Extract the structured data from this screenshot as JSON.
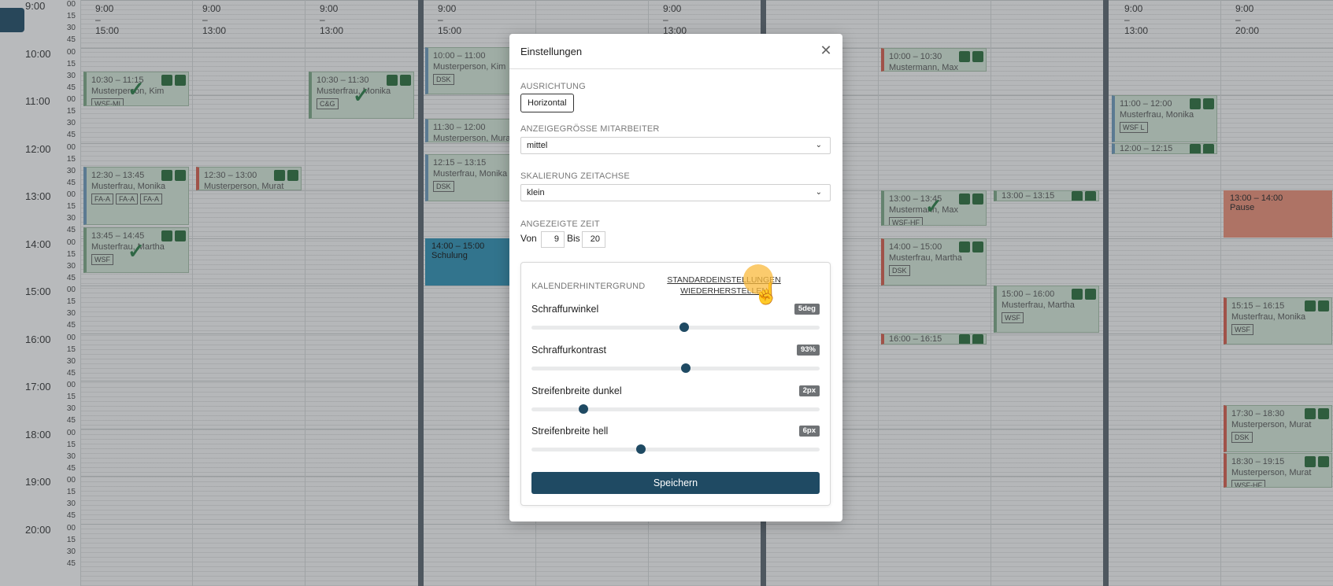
{
  "time_axis": {
    "hours": [
      {
        "label": "9:00",
        "minutes": [
          "00",
          "15",
          "30",
          "45"
        ]
      },
      {
        "label": "10:00",
        "minutes": [
          "00",
          "15",
          "30",
          "45"
        ]
      },
      {
        "label": "11:00",
        "minutes": [
          "00",
          "15",
          "30",
          "45"
        ]
      },
      {
        "label": "12:00",
        "minutes": [
          "00",
          "15",
          "30",
          "45"
        ]
      },
      {
        "label": "13:00",
        "minutes": [
          "00",
          "15",
          "30",
          "45"
        ]
      },
      {
        "label": "14:00",
        "minutes": [
          "00",
          "15",
          "30",
          "45"
        ]
      },
      {
        "label": "15:00",
        "minutes": [
          "00",
          "15",
          "30",
          "45"
        ]
      },
      {
        "label": "16:00",
        "minutes": [
          "00",
          "15",
          "30",
          "45"
        ]
      },
      {
        "label": "17:00",
        "minutes": [
          "00",
          "15",
          "30",
          "45"
        ]
      },
      {
        "label": "18:00",
        "minutes": [
          "00",
          "15",
          "30",
          "45"
        ]
      },
      {
        "label": "19:00",
        "minutes": [
          "00",
          "15",
          "30",
          "45"
        ]
      },
      {
        "label": "20:00",
        "minutes": [
          "00",
          "15",
          "30",
          "45"
        ]
      }
    ]
  },
  "columns": [
    {
      "header": "9:00 – 15:00"
    },
    {
      "header": "9:00 – 13:00"
    },
    {
      "header": "9:00 – 13:00"
    },
    {
      "header": "9:00 – 15:00"
    },
    {
      "header": ""
    },
    {
      "header": "9:00 – 13:00"
    },
    {
      "header": ""
    },
    {
      "header": ""
    },
    {
      "header": ""
    },
    {
      "header": ""
    },
    {
      "header": "9:00 – 13:00"
    },
    {
      "header": "9:00 – 20:00"
    }
  ],
  "appointments": [
    {
      "time": "10:30 – 11:15",
      "person": "Musterperson, Kim",
      "tags": [
        "WSF-MI"
      ]
    },
    {
      "time": "10:30 – 11:30",
      "person": "Musterfrau, Monika",
      "tags": [
        "C&G"
      ]
    },
    {
      "time": "10:00 – 11:00",
      "person": "Musterperson, Kim",
      "tags": [
        "DSK"
      ]
    },
    {
      "time": "11:30 – 12:00",
      "person": "Musterperson, Murat",
      "tags": []
    },
    {
      "time": "12:15 – 13:15",
      "person": "Musterfrau, Monika",
      "tags": [
        "DSK"
      ]
    },
    {
      "time": "12:30 – 13:45",
      "person": "Musterfrau, Monika",
      "tags": [
        "FA-A",
        "FA-A",
        "FA-A"
      ]
    },
    {
      "time": "12:30 – 13:00",
      "person": "Musterperson, Murat",
      "tags": []
    },
    {
      "time": "13:45 – 14:45",
      "person": "Musterfrau, Martha",
      "tags": [
        "WSF"
      ]
    },
    {
      "time": "10:00 – 10:30",
      "person": "Mustermann, Max",
      "tags": []
    },
    {
      "time": "13:00 – 13:45",
      "person": "Mustermann, Max",
      "tags": [
        "WSF-HF"
      ]
    },
    {
      "time": "14:00 – 15:00",
      "person": "Musterfrau, Martha",
      "tags": [
        "DSK"
      ]
    },
    {
      "time": "16:00 – 16:15",
      "person": "",
      "tags": []
    },
    {
      "time": "13:00 – 13:15",
      "person": "",
      "tags": []
    },
    {
      "time": "15:00 – 16:00",
      "person": "Musterfrau, Martha",
      "tags": [
        "WSF"
      ]
    },
    {
      "time": "11:00 – 12:00",
      "person": "Musterfrau, Monika",
      "tags": [
        "WSF L"
      ]
    },
    {
      "time": "12:00 – 12:15",
      "person": "",
      "tags": []
    },
    {
      "time": "15:15 – 16:15",
      "person": "Musterfrau, Monika",
      "tags": [
        "WSF"
      ]
    },
    {
      "time": "17:30 – 18:30",
      "person": "Musterperson, Murat",
      "tags": [
        "DSK"
      ]
    },
    {
      "time": "18:30 – 19:15",
      "person": "Musterperson, Murat",
      "tags": [
        "WSF-HF"
      ]
    }
  ],
  "special": {
    "school": {
      "time": "14:00 – 15:00",
      "title": "Schulung"
    },
    "pause": {
      "time": "13:00 – 14:00",
      "title": "Pause"
    }
  },
  "modal": {
    "title": "Einstellungen",
    "close_icon": "close-icon",
    "orientation": {
      "label": "AUSRICHTUNG",
      "value": "Horizontal"
    },
    "display_size": {
      "label": "ANZEIGEGRÖSSE MITARBEITER",
      "value": "mittel"
    },
    "time_scale": {
      "label": "SKALIERUNG ZEITACHSE",
      "value": "klein"
    },
    "displayed_time": {
      "label": "ANGEZEIGTE ZEIT",
      "from_label": "Von",
      "from_value": "9",
      "to_label": "Bis",
      "to_value": "20"
    },
    "background": {
      "title": "KALENDERHINTERGRUND",
      "reset_line1": "STANDARDEINSTELLUNGEN",
      "reset_line2": "WIEDERHERSTELLEN",
      "sliders": [
        {
          "label": "Schraffurwinkel",
          "value": "5deg",
          "fraction": 0.53
        },
        {
          "label": "Schraffurkontrast",
          "value": "93%",
          "fraction": 0.535
        },
        {
          "label": "Streifenbreite dunkel",
          "value": "2px",
          "fraction": 0.18
        },
        {
          "label": "Streifenbreite hell",
          "value": "6px",
          "fraction": 0.38
        }
      ],
      "save": "Speichern"
    }
  },
  "colors": {
    "primary": "#1f4a63",
    "school": "#2e8cae",
    "pause": "#e58b74",
    "appointment": "#cfe0d2"
  }
}
